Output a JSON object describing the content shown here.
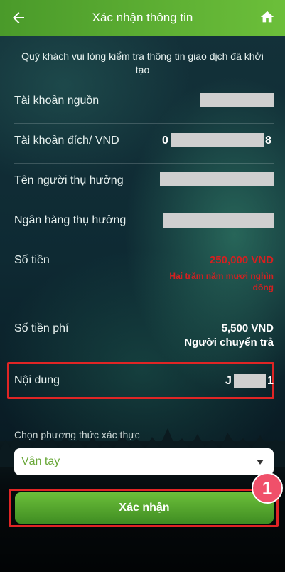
{
  "header": {
    "title": "Xác nhận thông tin"
  },
  "intro": "Quý khách vui lòng kiểm tra thông tin giao dịch đã khởi tạo",
  "rows": {
    "source": {
      "label": "Tài khoản nguồn"
    },
    "dest": {
      "label": "Tài khoản đích/ VND",
      "prefix": "0",
      "suffix": "8"
    },
    "beneficiary_name": {
      "label": "Tên người thụ hưởng"
    },
    "beneficiary_bank": {
      "label": "Ngân hàng thụ hưởng"
    },
    "amount": {
      "label": "Số tiền",
      "value": "250,000 VND",
      "words": "Hai trăm năm mươi nghìn đồng"
    },
    "fee": {
      "label": "Số tiền phí",
      "value": "5,500 VND",
      "payer": "Người chuyển trả"
    },
    "content": {
      "label": "Nội dung",
      "prefix": "J",
      "suffix": "1"
    }
  },
  "auth": {
    "label": "Chọn phương thức xác thực",
    "selected": "Vân tay"
  },
  "confirm_button": "Xác nhận",
  "step_badge": "1",
  "colors": {
    "header_green": "#5aac32",
    "amount_red": "#d42020",
    "highlight_red": "#e02525",
    "badge_pink": "#f0506a"
  }
}
